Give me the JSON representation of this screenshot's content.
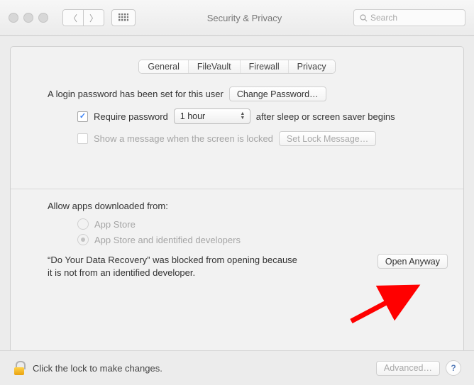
{
  "toolbar": {
    "title": "Security & Privacy",
    "search_placeholder": "Search"
  },
  "tabs": [
    {
      "label": "General",
      "active": true
    },
    {
      "label": "FileVault",
      "active": false
    },
    {
      "label": "Firewall",
      "active": false
    },
    {
      "label": "Privacy",
      "active": false
    }
  ],
  "login": {
    "password_set_text": "A login password has been set for this user",
    "change_password_btn": "Change Password…",
    "require_password_label_pre": "Require password",
    "require_password_label_post": "after sleep or screen saver begins",
    "require_password_delay": "1 hour",
    "show_message_label": "Show a message when the screen is locked",
    "set_lock_btn": "Set Lock Message…"
  },
  "gatekeeper": {
    "section_label": "Allow apps downloaded from:",
    "option_appstore": "App Store",
    "option_identified": "App Store and identified developers",
    "blocked_text": "“Do Your Data Recovery” was blocked from opening because it is not from an identified developer.",
    "open_anyway_btn": "Open Anyway"
  },
  "footer": {
    "lock_text": "Click the lock to make changes.",
    "advanced_btn": "Advanced…"
  }
}
